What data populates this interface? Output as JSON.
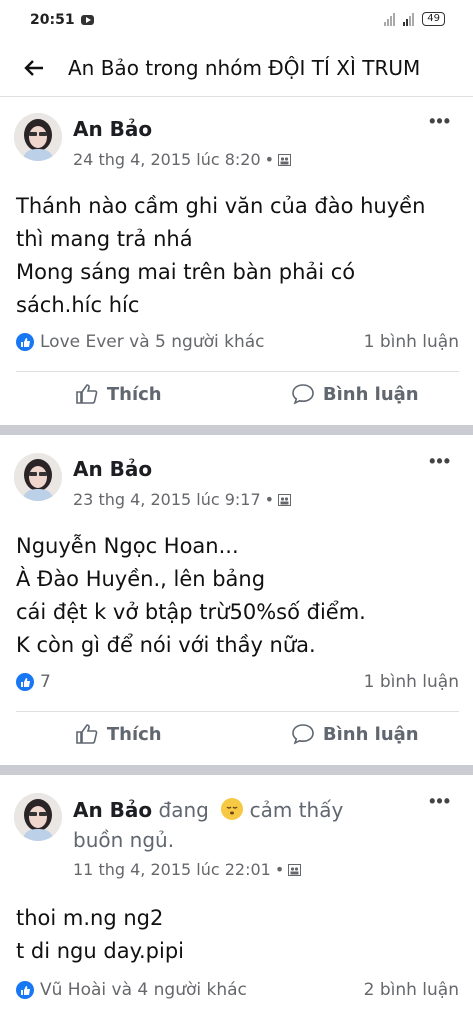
{
  "status": {
    "time": "20:51",
    "battery": "49"
  },
  "header": {
    "title": "An Bảo trong nhóm ĐỘI TÍ XÌ TRUM"
  },
  "posts": [
    {
      "author": "An Bảo",
      "date": "24 thg 4, 2015 lúc 8:20",
      "dot": "•",
      "text": "Thánh nào cầm ghi văn của đào huyền\nthì mang trả nhá\nMong sáng mai trên bàn phải có\nsách.híc híc",
      "reactions": "Love Ever và 5 người khác",
      "comments": "1 bình luận",
      "like_label": "Thích",
      "comment_label": "Bình luận"
    },
    {
      "author": "An Bảo",
      "date": "23 thg 4, 2015 lúc 9:17",
      "dot": "•",
      "text": "Nguyễn Ngọc Hoan...\nÀ Đào Huyền., lên bảng\ncái đệt k vở btập trừ50%số điểm.\nK còn gì để nói với thầy nữa.",
      "reactions": "7",
      "comments": "1 bình luận",
      "like_label": "Thích",
      "comment_label": "Bình luận"
    },
    {
      "author": "An Bảo",
      "feeling_prefix": "đang",
      "feeling": "cảm thấy",
      "feeling_line2": "buồn ngủ.",
      "date": "11 thg 4, 2015 lúc 22:01",
      "dot": "•",
      "text": "thoi m.ng ng2\nt di ngu day.pipi",
      "reactions": "Vũ Hoài và 4 người khác",
      "comments": "2 bình luận"
    }
  ],
  "colors": {
    "accent": "#1877f2",
    "separator": "#c9ccd1",
    "meta": "#65676b"
  }
}
